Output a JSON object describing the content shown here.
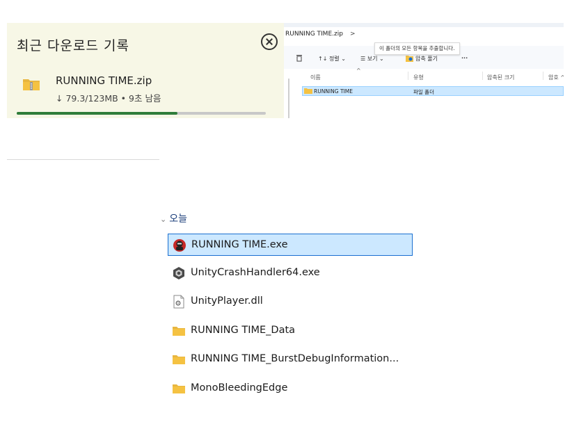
{
  "download_panel": {
    "title": "최근 다운로드 기록",
    "file_name": "RUNNING TIME.zip",
    "status": "↓ 79.3/123MB • 9초 남음",
    "progress": 0.645,
    "icons": {
      "close": "close-circle-icon",
      "file": "zip-folder-icon"
    }
  },
  "explorer": {
    "breadcrumb": "RUNNING TIME.zip",
    "breadcrumb_chevron": ">",
    "tooltip": "이 폴더의 모든 항목을 추출합니다.",
    "toolbar": {
      "delete_icon": "trash-icon",
      "sort": "↑↓ 정렬 ⌄",
      "view": "☰ 보기 ⌄",
      "extract": "압축 풀기",
      "more": "···"
    },
    "columns": [
      "이름",
      "유형",
      "압축된 크기",
      "암호 ^"
    ],
    "sort_arrow": "^",
    "rows": [
      {
        "name": "RUNNING TIME",
        "type": "파일 폴더"
      }
    ]
  },
  "file_list": {
    "group_label": "오늘",
    "group_chevron": "⌄",
    "items": [
      {
        "name": "RUNNING TIME.exe",
        "icon": "game-app-icon",
        "selected": true
      },
      {
        "name": "UnityCrashHandler64.exe",
        "icon": "unity-exe-icon",
        "selected": false
      },
      {
        "name": "UnityPlayer.dll",
        "icon": "dll-file-icon",
        "selected": false
      },
      {
        "name": "RUNNING TIME_Data",
        "icon": "folder-icon",
        "selected": false
      },
      {
        "name": "RUNNING TIME_BurstDebugInformation...",
        "icon": "folder-icon",
        "selected": false
      },
      {
        "name": "MonoBleedingEdge",
        "icon": "folder-icon",
        "selected": false
      }
    ]
  },
  "colors": {
    "panel_bg": "#f7f7e6",
    "progress_fill": "#2f7d3a",
    "selection_bg": "#cce8ff",
    "selection_border": "#1a6fd0",
    "folder_yellow": "#f5c242"
  }
}
